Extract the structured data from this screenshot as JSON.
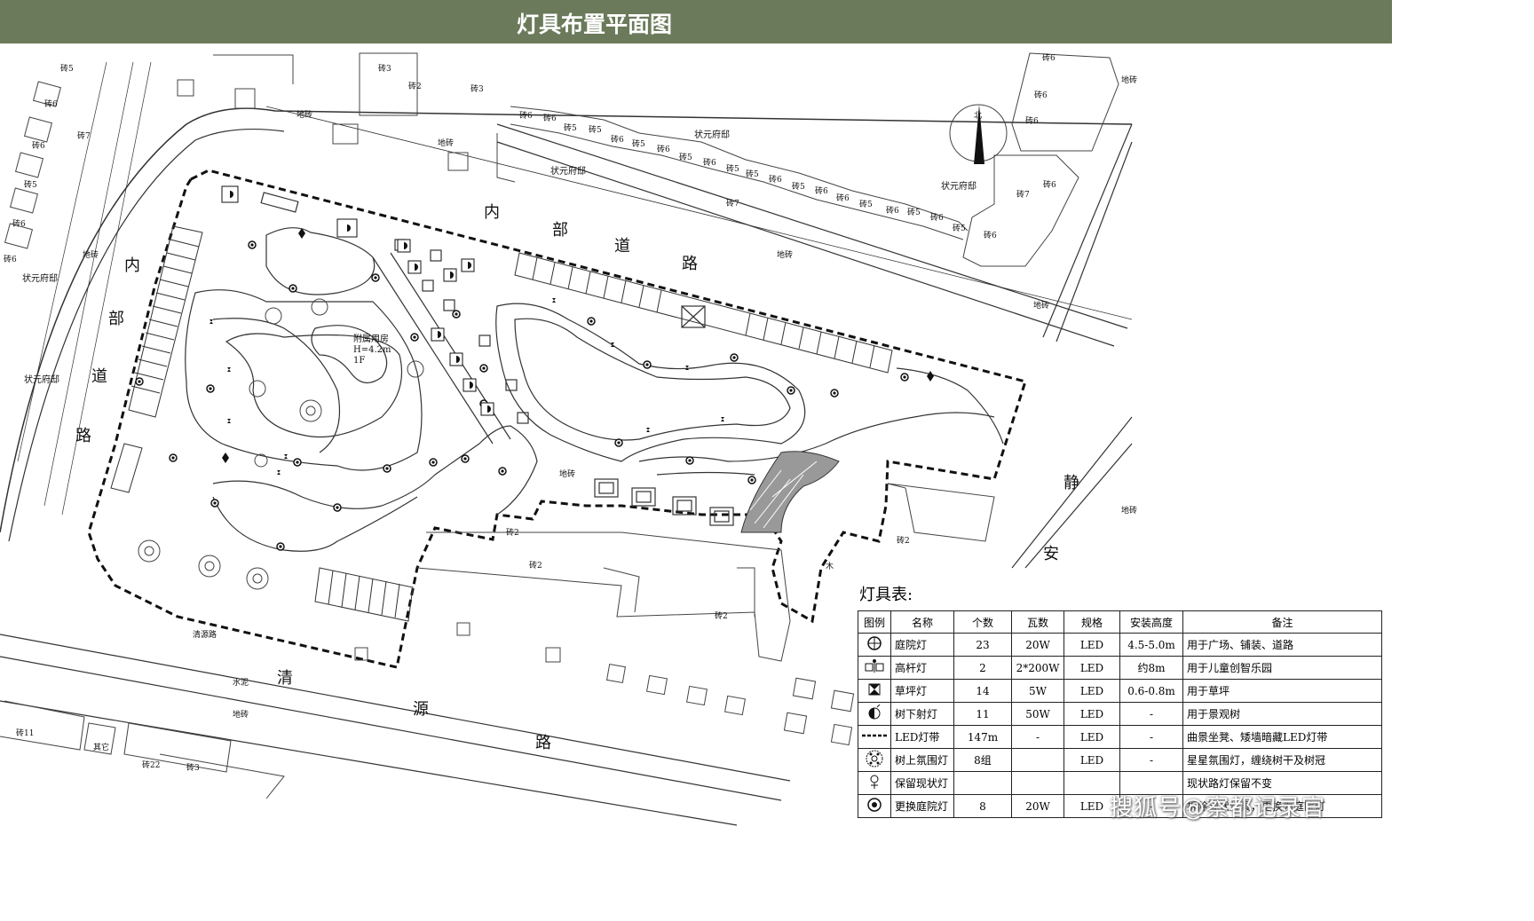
{
  "header": {
    "title": "灯具布置平面图"
  },
  "map": {
    "roads": {
      "inner_top": [
        "内",
        "部",
        "道",
        "路"
      ],
      "inner_left": [
        "内",
        "部",
        "道",
        "路"
      ],
      "south": [
        "清",
        "源",
        "路"
      ],
      "east": [
        "静",
        "安"
      ],
      "south_small": "清源路"
    },
    "buildings": {
      "zhuangyuan": "状元府邸",
      "pavilion": "附属用房",
      "pavilion_h": "H=4.2m",
      "pavilion_f": "1F",
      "brick": "砖2",
      "brick3": "砖3",
      "brick5": "砖5",
      "brick6": "砖6",
      "brick7": "砖7",
      "brick11": "砖11",
      "brick22": "砖22",
      "floor": "地砖",
      "cement": "水泥",
      "wood": "木",
      "other": "其它",
      "north": "北"
    }
  },
  "legend": {
    "title": "灯具表:",
    "headers": [
      "图例",
      "名称",
      "个数",
      "瓦数",
      "规格",
      "安装高度",
      "备注"
    ],
    "rows": [
      {
        "icon": "courtyard-lamp-icon",
        "name": "庭院灯",
        "qty": "23",
        "watt": "20W",
        "spec": "LED",
        "height": "4.5-5.0m",
        "note": "用于广场、铺装、道路"
      },
      {
        "icon": "high-pole-lamp-icon",
        "name": "高杆灯",
        "qty": "2",
        "watt": "2*200W",
        "spec": "LED",
        "height": "约8m",
        "note": "用于儿童创智乐园"
      },
      {
        "icon": "lawn-lamp-icon",
        "name": "草坪灯",
        "qty": "14",
        "watt": "5W",
        "spec": "LED",
        "height": "0.6-0.8m",
        "note": "用于草坪"
      },
      {
        "icon": "tree-uplight-icon",
        "name": "树下射灯",
        "qty": "11",
        "watt": "50W",
        "spec": "LED",
        "height": "-",
        "note": "用于景观树"
      },
      {
        "icon": "led-strip-icon",
        "name": "LED灯带",
        "qty": "147m",
        "watt": "-",
        "spec": "LED",
        "height": "-",
        "note": "曲景坐凳、矮墙暗藏LED灯带"
      },
      {
        "icon": "tree-ambient-lamp-icon",
        "name": "树上氛围灯",
        "qty": "8组",
        "watt": "",
        "spec": "LED",
        "height": "-",
        "note": "星星氛围灯，缠绕树干及树冠"
      },
      {
        "icon": "retained-lamp-icon",
        "name": "保留现状灯",
        "qty": "",
        "watt": "",
        "spec": "",
        "height": "",
        "note": "现状路灯保留不变"
      },
      {
        "icon": "replace-courtyard-lamp-icon",
        "name": "更换庭院灯",
        "qty": "8",
        "watt": "20W",
        "spec": "LED",
        "height": "-",
        "note": "拆除现状灯具，更换为庭院灯"
      }
    ]
  },
  "watermark": "搜狐号@察都记录官"
}
